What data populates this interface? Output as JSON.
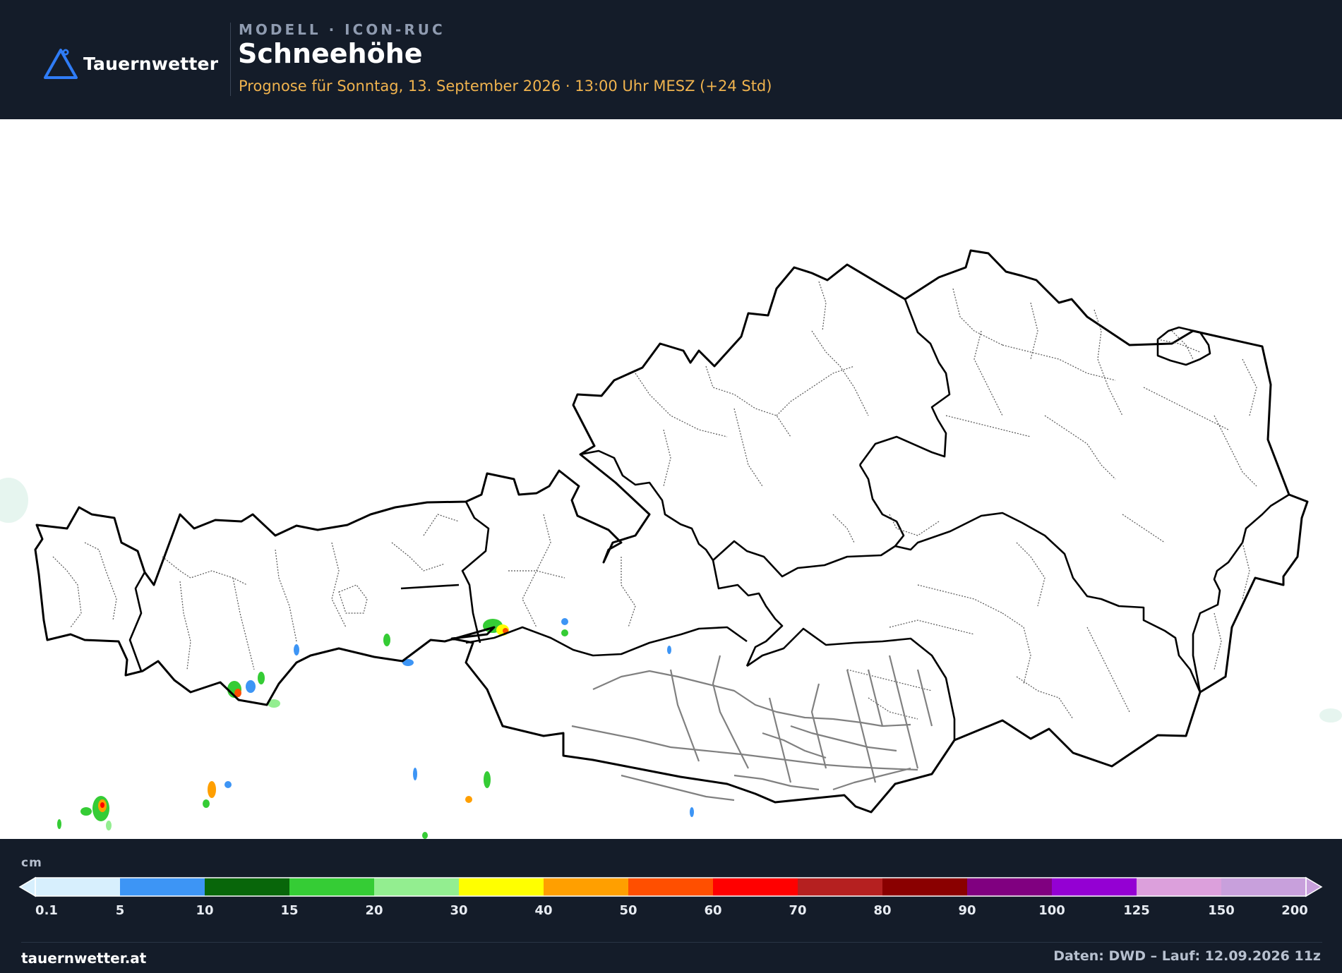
{
  "header": {
    "brand": "Tauernwetter",
    "model_label": "MODELL · ICON-RUC",
    "title": "Schneehöhe",
    "subtitle": "Prognose für Sonntag, 13. September 2026 · 13:00 Uhr MESZ  (+24 Std)",
    "logo_icon": "mountain-pin-icon",
    "accent_color": "#2f7cf6",
    "subtitle_color": "#f0b34e"
  },
  "legend": {
    "unit": "cm",
    "ticks": [
      "0.1",
      "5",
      "10",
      "15",
      "20",
      "30",
      "40",
      "50",
      "60",
      "70",
      "80",
      "90",
      "100",
      "125",
      "150",
      "200"
    ],
    "colors": [
      "#d7effd",
      "#3d95f5",
      "#08660a",
      "#35cc35",
      "#93ee90",
      "#ffff00",
      "#ff9f00",
      "#ff4f00",
      "#ff0000",
      "#b52020",
      "#8a0000",
      "#800080",
      "#9400d3",
      "#dca0dc",
      "#c8a0dc"
    ]
  },
  "footer": {
    "site": "tauernwetter.at",
    "credit": "Daten: DWD – Lauf: 12.09.2026 11z"
  }
}
